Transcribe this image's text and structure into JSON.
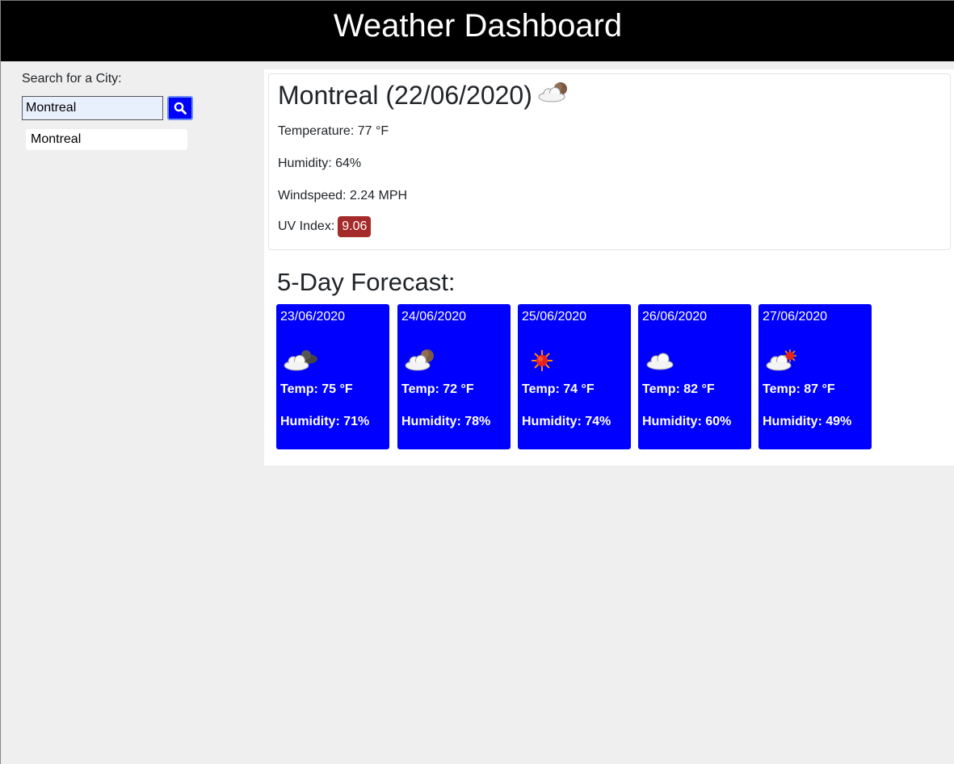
{
  "header": {
    "title": "Weather Dashboard"
  },
  "sidebar": {
    "search_label": "Search for a City:",
    "search_value": "Montreal",
    "history": [
      "Montreal"
    ]
  },
  "current": {
    "city_date": "Montreal (22/06/2020)",
    "icon": "partly-cloudy-night-icon",
    "temperature": "Temperature: 77 °F",
    "humidity": "Humidity: 64%",
    "windspeed": "Windspeed: 2.24 MPH",
    "uv_label": "UV Index:",
    "uv_value": "9.06",
    "uv_color": "#a52a2a"
  },
  "forecast": {
    "title": "5-Day Forecast:",
    "card_color": "#0000ff",
    "days": [
      {
        "date": "23/06/2020",
        "icon": "broken-clouds-night-icon",
        "temp": "Temp: 75 °F",
        "humidity": "Humidity: 71%"
      },
      {
        "date": "24/06/2020",
        "icon": "partly-cloudy-night-icon",
        "temp": "Temp: 72 °F",
        "humidity": "Humidity: 78%"
      },
      {
        "date": "25/06/2020",
        "icon": "clear-sun-icon",
        "temp": "Temp: 74 °F",
        "humidity": "Humidity: 74%"
      },
      {
        "date": "26/06/2020",
        "icon": "cloud-icon",
        "temp": "Temp: 82 °F",
        "humidity": "Humidity: 60%"
      },
      {
        "date": "27/06/2020",
        "icon": "partly-cloudy-day-icon",
        "temp": "Temp: 87 °F",
        "humidity": "Humidity: 49%"
      }
    ]
  }
}
